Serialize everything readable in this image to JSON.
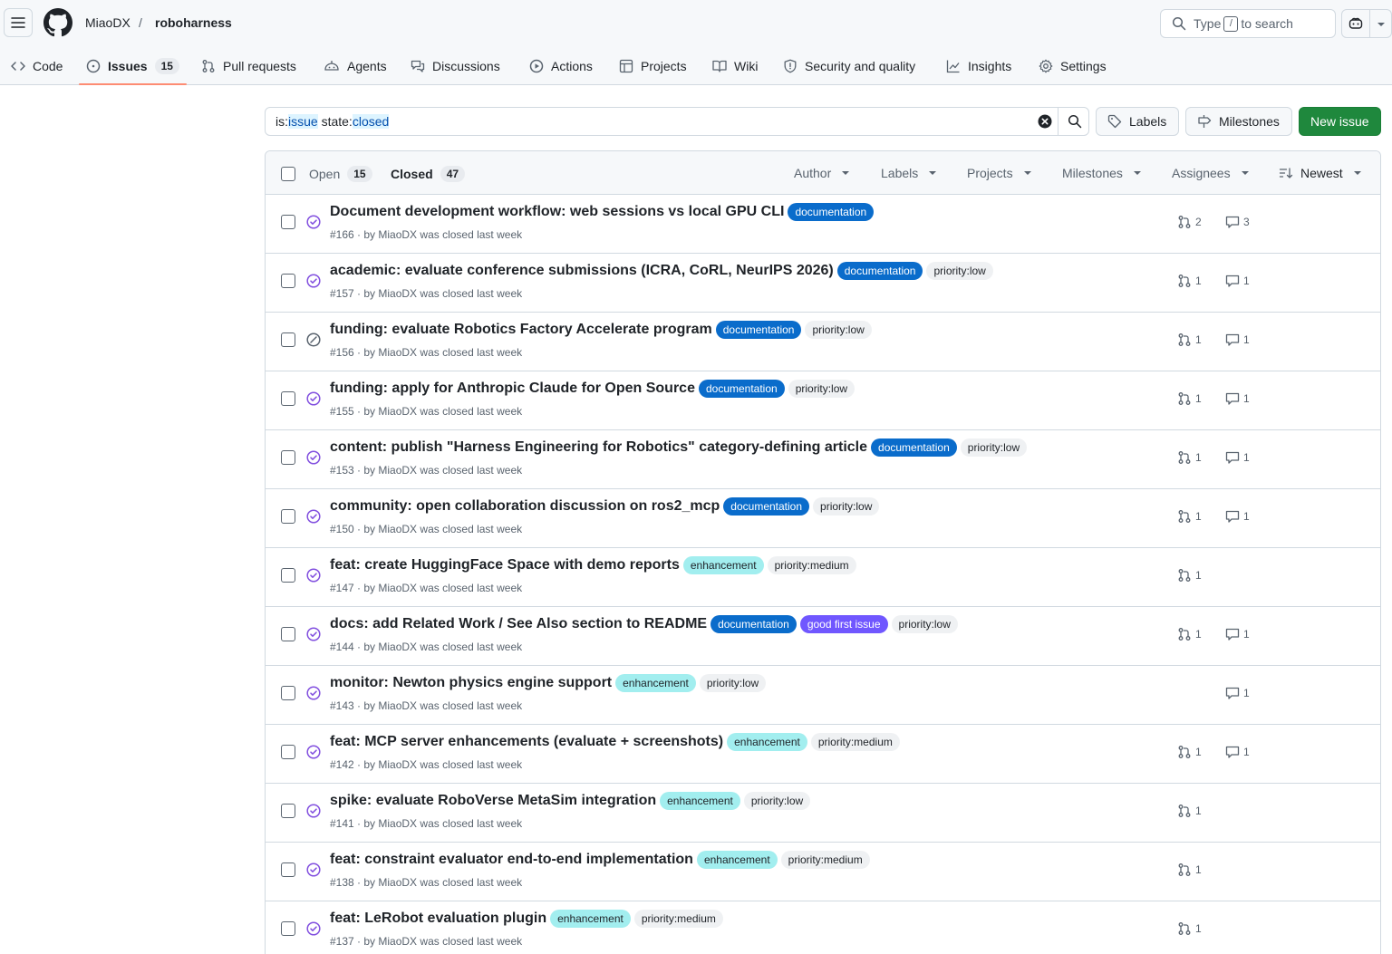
{
  "header": {
    "owner": "MiaoDX",
    "separator": "/",
    "repo": "roboharness",
    "search_prefix": "Type",
    "search_key": "/",
    "search_suffix": "to search"
  },
  "tabs": [
    {
      "label": "Code",
      "icon": "code-icon"
    },
    {
      "label": "Issues",
      "icon": "issue-icon",
      "count": "15",
      "active": true
    },
    {
      "label": "Pull requests",
      "icon": "pull-request-icon"
    },
    {
      "label": "Agents",
      "icon": "agent-icon"
    },
    {
      "label": "Discussions",
      "icon": "discussion-icon"
    },
    {
      "label": "Actions",
      "icon": "play-icon"
    },
    {
      "label": "Projects",
      "icon": "table-icon"
    },
    {
      "label": "Wiki",
      "icon": "book-icon"
    },
    {
      "label": "Security and quality",
      "icon": "shield-icon"
    },
    {
      "label": "Insights",
      "icon": "graph-icon"
    },
    {
      "label": "Settings",
      "icon": "gear-icon"
    }
  ],
  "filter": {
    "part1": "is:",
    "part2": "issue",
    "part3": " state:",
    "part4": "closed"
  },
  "buttons": {
    "labels": "Labels",
    "milestones": "Milestones",
    "new_issue": "New issue"
  },
  "list_header": {
    "open_label": "Open",
    "open_count": "15",
    "closed_label": "Closed",
    "closed_count": "47",
    "filters": [
      "Author",
      "Labels",
      "Projects",
      "Milestones",
      "Assignees"
    ],
    "sort": "Newest"
  },
  "issues": [
    {
      "title": "Document development workflow: web sessions vs local GPU CLI",
      "labels": [
        "documentation"
      ],
      "number": "#166",
      "meta": "by MiaoDX was closed last week",
      "prs": "2",
      "comments": "3",
      "state": "completed"
    },
    {
      "title": "academic: evaluate conference submissions (ICRA, CoRL, NeurIPS 2026)",
      "labels": [
        "documentation",
        "priority:low"
      ],
      "number": "#157",
      "meta": "by MiaoDX was closed last week",
      "prs": "1",
      "comments": "1",
      "state": "completed"
    },
    {
      "title": "funding: evaluate Robotics Factory Accelerate program",
      "labels": [
        "documentation",
        "priority:low"
      ],
      "number": "#156",
      "meta": "by MiaoDX was closed last week",
      "prs": "1",
      "comments": "1",
      "state": "not-planned"
    },
    {
      "title": "funding: apply for Anthropic Claude for Open Source",
      "labels": [
        "documentation",
        "priority:low"
      ],
      "number": "#155",
      "meta": "by MiaoDX was closed last week",
      "prs": "1",
      "comments": "1",
      "state": "completed"
    },
    {
      "title": "content: publish \"Harness Engineering for Robotics\" category-defining article",
      "labels": [
        "documentation",
        "priority:low"
      ],
      "number": "#153",
      "meta": "by MiaoDX was closed last week",
      "prs": "1",
      "comments": "1",
      "state": "completed"
    },
    {
      "title": "community: open collaboration discussion on ros2_mcp",
      "labels": [
        "documentation",
        "priority:low"
      ],
      "number": "#150",
      "meta": "by MiaoDX was closed last week",
      "prs": "1",
      "comments": "1",
      "state": "completed"
    },
    {
      "title": "feat: create HuggingFace Space with demo reports",
      "labels": [
        "enhancement",
        "priority:medium"
      ],
      "number": "#147",
      "meta": "by MiaoDX was closed last week",
      "prs": "1",
      "comments": "",
      "state": "completed"
    },
    {
      "title": "docs: add Related Work / See Also section to README",
      "labels": [
        "documentation",
        "good first issue",
        "priority:low"
      ],
      "number": "#144",
      "meta": "by MiaoDX was closed last week",
      "prs": "1",
      "comments": "1",
      "state": "completed"
    },
    {
      "title": "monitor: Newton physics engine support",
      "labels": [
        "enhancement",
        "priority:low"
      ],
      "number": "#143",
      "meta": "by MiaoDX was closed last week",
      "prs": "",
      "comments": "1",
      "state": "completed"
    },
    {
      "title": "feat: MCP server enhancements (evaluate + screenshots)",
      "labels": [
        "enhancement",
        "priority:medium"
      ],
      "number": "#142",
      "meta": "by MiaoDX was closed last week",
      "prs": "1",
      "comments": "1",
      "state": "completed"
    },
    {
      "title": "spike: evaluate RoboVerse MetaSim integration",
      "labels": [
        "enhancement",
        "priority:low"
      ],
      "number": "#141",
      "meta": "by MiaoDX was closed last week",
      "prs": "1",
      "comments": "",
      "state": "completed"
    },
    {
      "title": "feat: constraint evaluator end-to-end implementation",
      "labels": [
        "enhancement",
        "priority:medium"
      ],
      "number": "#138",
      "meta": "by MiaoDX was closed last week",
      "prs": "1",
      "comments": "",
      "state": "completed"
    },
    {
      "title": "feat: LeRobot evaluation plugin",
      "labels": [
        "enhancement",
        "priority:medium"
      ],
      "number": "#137",
      "meta": "by MiaoDX was closed last week",
      "prs": "1",
      "comments": "",
      "state": "completed"
    }
  ],
  "colors": {
    "documentation": "#0a6ccb",
    "enhancement": "#a2eeef",
    "good_first_issue": "#7057ff",
    "priority": "#eff1f3",
    "closed_purple": "#8250df",
    "not_planned_gray": "#59636e",
    "primary_green": "#1f883d",
    "tab_underline": "#fd8c73"
  }
}
